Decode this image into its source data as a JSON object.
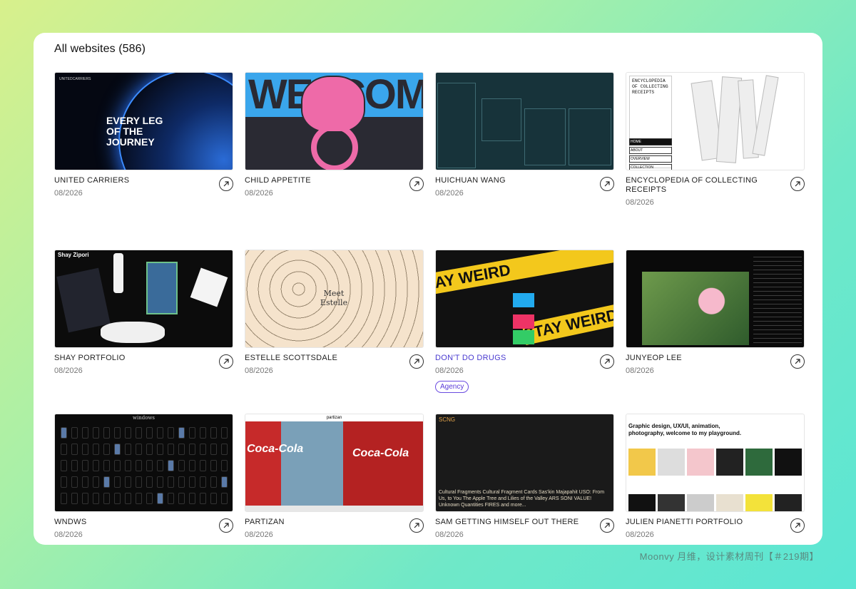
{
  "header": {
    "title": "All websites (586)"
  },
  "tiles": [
    {
      "name": "UNITED CARRIERS",
      "date": "08/2026"
    },
    {
      "name": "CHILD APPETITE",
      "date": "08/2026"
    },
    {
      "name": "HUICHUAN WANG",
      "date": "08/2026"
    },
    {
      "name": "ENCYCLOPEDIA OF COLLECTING RECEIPTS",
      "date": "08/2026"
    },
    {
      "name": "SHAY PORTFOLIO",
      "date": "08/2026"
    },
    {
      "name": "ESTELLE SCOTTSDALE",
      "date": "08/2026"
    },
    {
      "name": "DON'T DO DRUGS",
      "date": "08/2026",
      "tag": "Agency"
    },
    {
      "name": "JUNYEOP LEE",
      "date": "08/2026"
    },
    {
      "name": "WNDWS",
      "date": "08/2026"
    },
    {
      "name": "PARTIZAN",
      "date": "08/2026"
    },
    {
      "name": "SAM GETTING HIMSELF OUT THERE",
      "date": "08/2026"
    },
    {
      "name": "JULIEN PIANETTI PORTFOLIO",
      "date": "08/2026"
    }
  ],
  "thumb_text": {
    "uc_headline": "EVERY LEG OF THE JOURNEY",
    "uc_logo": "UNITEDCARRIERS",
    "ca_word": "WELCOME",
    "ec_book": "ENCYCLOPEDIA OF COLLECTING RECEIPTS",
    "ec_nav": [
      "HOME",
      "ABOUT",
      "OVERVIEW",
      "COLLECTION"
    ],
    "sp_logo": "Shay Zipori",
    "es_title": "Meet Estelle",
    "dd_band": "STAY WEIRD",
    "wn_title": "windows",
    "pz_brand": "partizan",
    "pz_coke": "Coca-Cola",
    "sg_logo": "SCNG",
    "sg_text": "Cultural Fragments Cultural Fragment Cards Sas'kin Majapahit USO: From Us, to You The Apple Tree and Lilies of the Valley ARS SONI VALUE! Unknown Quantities FIRES and more...",
    "jp_heading": "Graphic design, UX/UI, animation, photography, welcome to my playground."
  },
  "colors": {
    "accent": "#5a3bd8",
    "background_start": "#d8f08c",
    "background_end": "#5be6d4"
  },
  "icons": {
    "tile_link": "arrow-up-right-icon"
  },
  "footer": {
    "credit": "Moonvy 月维，设计素材周刊【＃219期】"
  }
}
